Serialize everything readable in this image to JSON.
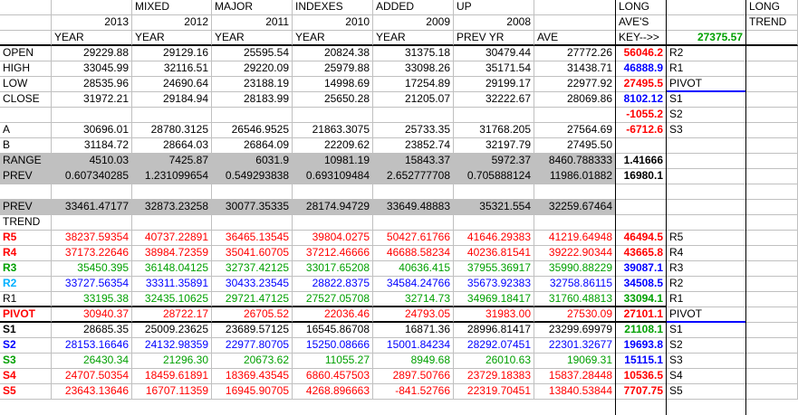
{
  "header": {
    "row1": [
      "",
      "",
      "MIXED",
      "MAJOR",
      "INDEXES",
      "ADDED",
      "UP",
      "",
      "LONG",
      "",
      "LONG"
    ],
    "row2": [
      "",
      "2013",
      "2012",
      "2011",
      "2010",
      "2009",
      "2008",
      "",
      "AVE'S",
      "",
      "TREND"
    ],
    "row3": [
      "",
      "YEAR",
      "YEAR",
      "YEAR",
      "YEAR",
      "YEAR",
      "PREV YR",
      "AVE",
      "KEY-->>",
      "27375.57",
      ""
    ]
  },
  "rows": [
    {
      "label": "OPEN",
      "vals": [
        "29229.88",
        "29129.16",
        "25595.54",
        "20824.38",
        "31375.18",
        "30479.44",
        "27772.26"
      ],
      "key": "56046.2",
      "keycolor": "red",
      "code": "R2"
    },
    {
      "label": "HIGH",
      "vals": [
        "33045.99",
        "32116.51",
        "29220.09",
        "25979.88",
        "33098.26",
        "35171.54",
        "31438.71"
      ],
      "key": "46888.9",
      "keycolor": "blue",
      "code": "R1"
    },
    {
      "label": "LOW",
      "vals": [
        "28535.96",
        "24690.64",
        "23188.19",
        "14998.69",
        "17254.89",
        "29199.17",
        "22977.92"
      ],
      "key": "27495.5",
      "keycolor": "red",
      "code": "PIVOT"
    },
    {
      "label": "CLOSE",
      "vals": [
        "31972.21",
        "29184.94",
        "28183.99",
        "25650.28",
        "21205.07",
        "32222.67",
        "28069.86"
      ],
      "key": "8102.12",
      "keycolor": "blue",
      "code": "S1"
    },
    {
      "label": "",
      "vals": [
        "",
        "",
        "",
        "",
        "",
        "",
        ""
      ],
      "key": "-1055.2",
      "keycolor": "red",
      "code": "S2"
    },
    {
      "label": "A",
      "vals": [
        "30696.01",
        "28780.3125",
        "26546.9525",
        "21863.3075",
        "25733.35",
        "31768.205",
        "27564.69"
      ],
      "key": "-6712.6",
      "keycolor": "red",
      "code": "S3"
    },
    {
      "label": "B",
      "vals": [
        "31184.72",
        "28664.03",
        "26864.09",
        "22209.62",
        "23852.74",
        "32197.79",
        "27495.50"
      ],
      "key": "",
      "keycolor": "",
      "code": ""
    },
    {
      "label": "RANGE",
      "vals": [
        "4510.03",
        "7425.87",
        "6031.9",
        "10981.19",
        "15843.37",
        "5972.37",
        "8460.788333"
      ],
      "key": "1.41666",
      "keycolor": "",
      "code": ""
    },
    {
      "label": "PREV",
      "vals": [
        "0.607340285",
        "1.231099654",
        "0.549293838",
        "0.693109484",
        "2.652777708",
        "0.705888124",
        "11986.01882"
      ],
      "key": "16980.1",
      "keycolor": "",
      "code": ""
    },
    {
      "label": "",
      "vals": [
        "",
        "",
        "",
        "",
        "",
        "",
        ""
      ],
      "key": "",
      "keycolor": "",
      "code": ""
    },
    {
      "label": "PREV",
      "vals": [
        "33461.47177",
        "32873.23258",
        "30077.35335",
        "28174.94729",
        "33649.48883",
        "35321.554",
        "32259.67464"
      ],
      "key": "",
      "keycolor": "",
      "code": ""
    },
    {
      "label": "TREND",
      "vals": [
        "",
        "",
        "",
        "",
        "",
        "",
        ""
      ],
      "key": "",
      "keycolor": "",
      "code": ""
    },
    {
      "label": "R5",
      "vals": [
        "38237.59354",
        "40737.22891",
        "36465.13545",
        "39804.0275",
        "50427.61766",
        "41646.29383",
        "41219.64948"
      ],
      "key": "46494.5",
      "keycolor": "red",
      "code": "R5"
    },
    {
      "label": "R4",
      "vals": [
        "37173.22646",
        "38984.72359",
        "35041.60705",
        "37212.46666",
        "46688.58234",
        "40236.81541",
        "39222.90344"
      ],
      "key": "43665.8",
      "keycolor": "red",
      "code": "R4"
    },
    {
      "label": "R3",
      "vals": [
        "35450.395",
        "36148.04125",
        "32737.42125",
        "33017.65208",
        "40636.415",
        "37955.36917",
        "35990.88229"
      ],
      "key": "39087.1",
      "keycolor": "blue",
      "code": "R3"
    },
    {
      "label": "R2",
      "vals": [
        "33727.56354",
        "33311.35891",
        "30433.23545",
        "28822.8375",
        "34584.24766",
        "35673.92383",
        "32758.86115"
      ],
      "key": "34508.5",
      "keycolor": "blue",
      "code": "R2"
    },
    {
      "label": "R1",
      "vals": [
        "33195.38",
        "32435.10625",
        "29721.47125",
        "27527.05708",
        "32714.73",
        "34969.18417",
        "31760.48813"
      ],
      "key": "33094.1",
      "keycolor": "green",
      "code": "R1"
    },
    {
      "label": "PIVOT",
      "vals": [
        "30940.37",
        "28722.17",
        "26705.52",
        "22036.46",
        "24793.05",
        "31983.00",
        "27530.09"
      ],
      "key": "27101.1",
      "keycolor": "red",
      "code": "PIVOT"
    },
    {
      "label": "S1",
      "vals": [
        "28685.35",
        "25009.23625",
        "23689.57125",
        "16545.86708",
        "16871.36",
        "28996.81417",
        "23299.69979"
      ],
      "key": "21108.1",
      "keycolor": "green",
      "code": "S1"
    },
    {
      "label": "S2",
      "vals": [
        "28153.16646",
        "24132.98359",
        "22977.80705",
        "15250.08666",
        "15001.84234",
        "28292.07451",
        "22301.32677"
      ],
      "key": "19693.8",
      "keycolor": "blue",
      "code": "S2"
    },
    {
      "label": "S3",
      "vals": [
        "26430.34",
        "21296.30",
        "20673.62",
        "11055.27",
        "8949.68",
        "26010.63",
        "19069.31"
      ],
      "key": "15115.1",
      "keycolor": "blue",
      "code": "S3"
    },
    {
      "label": "S4",
      "vals": [
        "24707.50354",
        "18459.61891",
        "18369.43545",
        "6860.457503",
        "2897.50766",
        "23729.18383",
        "15837.28448"
      ],
      "key": "10536.5",
      "keycolor": "red",
      "code": "S4"
    },
    {
      "label": "S5",
      "vals": [
        "23643.13646",
        "16707.11359",
        "16945.90705",
        "4268.896663",
        "-841.52766",
        "22319.70451",
        "13840.53844"
      ],
      "key": "7707.75",
      "keycolor": "red",
      "code": "S5"
    }
  ],
  "colors": {
    "red": "#ff0000",
    "blue": "#0000ff",
    "green": "#00a000",
    "cyan": "#00b0ff",
    "gray": "#c0c0c0"
  }
}
